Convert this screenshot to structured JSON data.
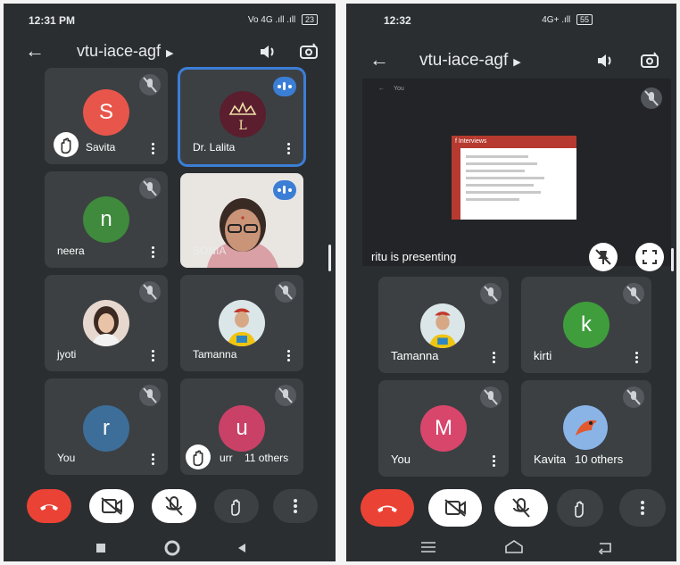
{
  "left_phone": {
    "status": {
      "time": "12:31 PM",
      "signal": "Vo 4G .ıll .ıll",
      "battery": "23"
    },
    "title": "vtu-iace-agf",
    "tiles": [
      {
        "name": "Savita",
        "initial": "S",
        "color": "#e8564b"
      },
      {
        "name": "Dr. Lalita"
      },
      {
        "name": "neera",
        "initial": "n",
        "color": "#3f8a3c"
      },
      {
        "name": "SONIA"
      },
      {
        "name": "jyoti"
      },
      {
        "name": "Tamanna"
      },
      {
        "name": "You",
        "initial": "r",
        "color": "#3d6e99"
      },
      {
        "name": "urr",
        "initial": "u",
        "color": "#c94167",
        "others": "11 others"
      }
    ]
  },
  "right_phone": {
    "status": {
      "time": "12:32",
      "signal": "4G+ .ıll",
      "battery": "55"
    },
    "title": "vtu-iace-agf",
    "presenting_label": "ritu is presenting",
    "slide": {
      "header": "f Interviews",
      "mini_name": "You"
    },
    "tiles": [
      {
        "name": "Tamanna"
      },
      {
        "name": "kirti",
        "initial": "k",
        "color": "#3f9d3c"
      },
      {
        "name": "You",
        "initial": "M",
        "color": "#d9466c"
      },
      {
        "name": "Kavita",
        "others": "10 others"
      }
    ]
  }
}
